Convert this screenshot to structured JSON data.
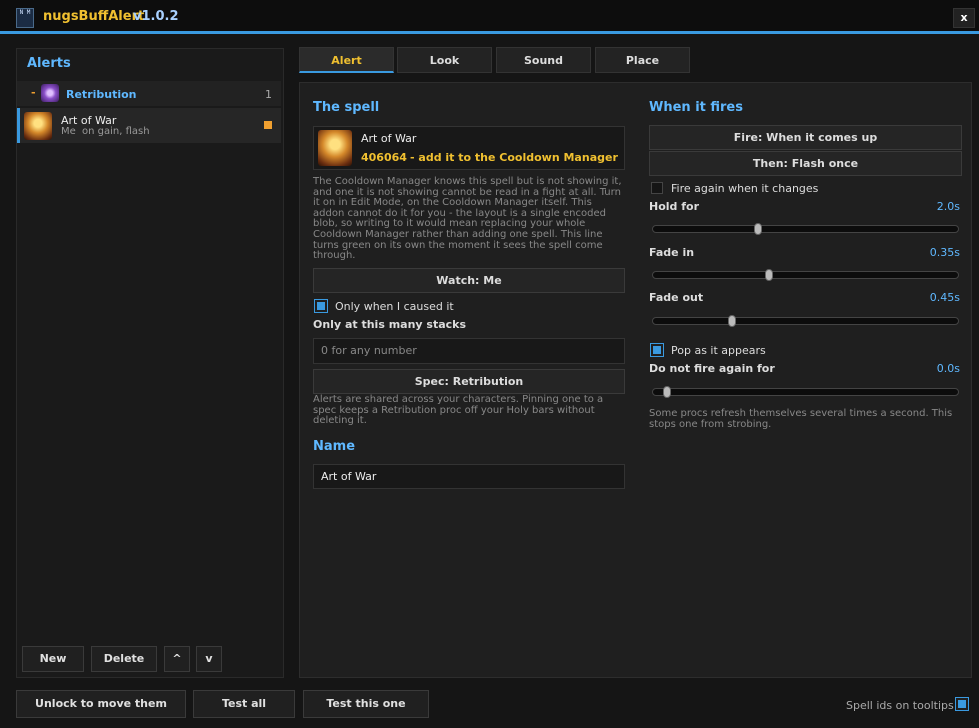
{
  "window": {
    "title": "nugsBuffAlert",
    "version": "v1.0.2",
    "close_label": "x",
    "logo_label": "N M"
  },
  "sidebar": {
    "title": "Alerts",
    "group": {
      "toggle": "-",
      "name": "Retribution",
      "count": "1",
      "icon": "holy-shield-icon"
    },
    "items": [
      {
        "name": "Art of War",
        "who": "Me",
        "what": "on gain, flash",
        "icon": "art-of-war-icon",
        "status_color": "#f0a030"
      }
    ],
    "buttons": {
      "new": "New",
      "delete": "Delete",
      "up": "^",
      "down": "v"
    }
  },
  "tabs": [
    {
      "label": "Alert",
      "active": true
    },
    {
      "label": "Look",
      "active": false
    },
    {
      "label": "Sound",
      "active": false
    },
    {
      "label": "Place",
      "active": false
    }
  ],
  "spell": {
    "title": "The spell",
    "name": "Art of War",
    "id": "406064",
    "hint": "-  add it to the Cooldown Manager",
    "cdm_note": "The Cooldown Manager knows this spell but is not showing it, and one it is not showing cannot be read in a fight at all. Turn it on in Edit Mode, on the Cooldown Manager itself. This addon cannot do it for you - the layout is a single encoded blob, so writing to it would mean replacing your whole Cooldown Manager rather than adding one spell. This line turns green on its own the moment it sees the spell come through.",
    "watch_label": "Watch: Me",
    "only_caused_label": "Only when I caused it",
    "only_caused": true,
    "stacks_label": "Only at this many stacks",
    "stacks_placeholder": "0 for any number",
    "spec_label": "Spec: Retribution",
    "spec_note": "Alerts are shared across your characters. Pinning one to a spec keeps a Retribution proc off your Holy bars without deleting it."
  },
  "name_section": {
    "title": "Name",
    "value": "Art of War"
  },
  "fires": {
    "title": "When it fires",
    "fire_label": "Fire: When it comes up",
    "then_label": "Then: Flash once",
    "again_label": "Fire again when it changes",
    "again": false,
    "hold": {
      "label": "Hold for",
      "value": "2.0s",
      "fraction": 0.33
    },
    "fade_in": {
      "label": "Fade in",
      "value": "0.35s",
      "fraction": 0.37
    },
    "fade_out": {
      "label": "Fade out",
      "value": "0.45s",
      "fraction": 0.235
    },
    "pop_label": "Pop as it appears",
    "pop": true,
    "not_again": {
      "label": "Do not fire again for",
      "value": "0.0s",
      "fraction": 0.0
    },
    "procs_note": "Some procs refresh themselves several times a second. This stops one from strobing."
  },
  "footer": {
    "unlock": "Unlock to move them",
    "test_all": "Test all",
    "test_one": "Test this one",
    "spell_ids_label": "Spell ids on tooltips",
    "spell_ids": true
  },
  "colors": {
    "accent": "#3a9ae0",
    "title_gold": "#f0c030",
    "section_blue": "#5fb8ff"
  }
}
